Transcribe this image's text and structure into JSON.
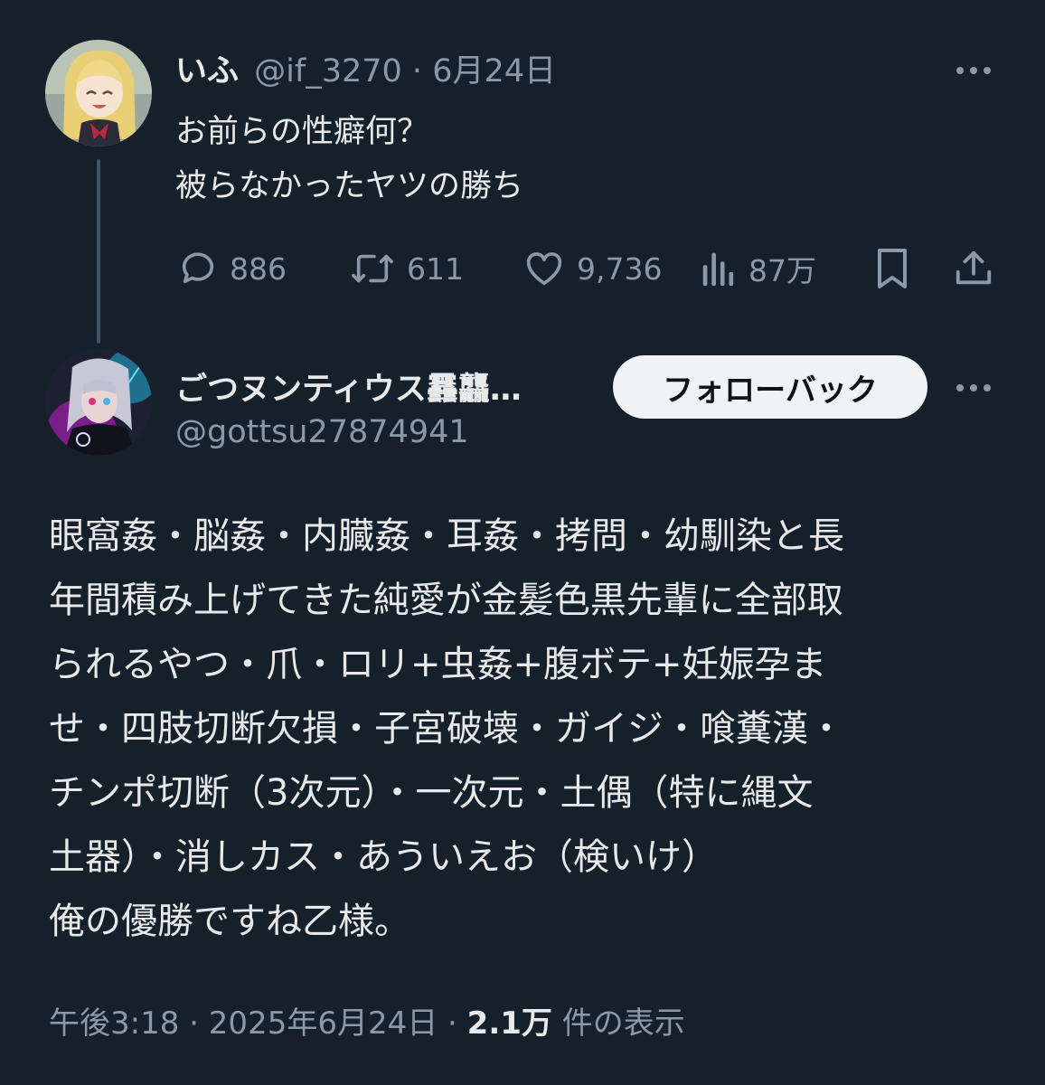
{
  "tweet1": {
    "display_name": "いふ",
    "handle": "@if_3270",
    "separator": "·",
    "date": "6月24日",
    "lines": [
      "お前らの性癖何？",
      "被らなかったヤツの勝ち"
    ],
    "actions": {
      "reply_icon": "reply-icon",
      "reply_count": "886",
      "retweet_icon": "retweet-icon",
      "retweet_count": "611",
      "like_icon": "heart-icon",
      "like_count": "9,736",
      "views_icon": "views-icon",
      "views_count": "87万",
      "bookmark_icon": "bookmark-icon",
      "share_icon": "share-icon"
    }
  },
  "tweet2": {
    "display_name": "ごつヌンティウス䨺龘…",
    "handle": "@gottsu27874941",
    "follow_button_label": "フォローバック",
    "lines": [
      "眼窩姦・脳姦・内臓姦・耳姦・拷問・幼馴染と長",
      "年間積み上げてきた純愛が金髪色黒先輩に全部取",
      "られるやつ・爪・ロリ+虫姦+腹ボテ+妊娠孕ま",
      "せ・四肢切断欠損・子宮破壊・ガイジ・喰糞漢・",
      "チンポ切断（3次元）・一次元・土偶（特に縄文",
      "土器）・消しカス・あういえお（検いけ）",
      "俺の優勝ですね乙様。"
    ],
    "time": "午後3:18",
    "separator": "·",
    "date": "2025年6月24日",
    "view_count": "2.1万",
    "view_label": "件の表示"
  },
  "colors": {
    "background": "#15202b",
    "primary_text": "#e7e9ea",
    "secondary_text": "#8b98a5",
    "thread_line": "#425364",
    "button_bg": "#eff3f4",
    "button_text": "#0f1419"
  }
}
